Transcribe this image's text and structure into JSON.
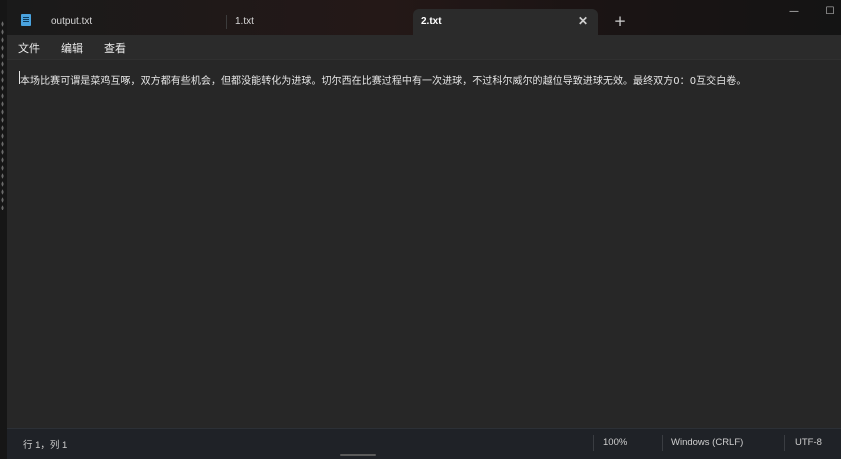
{
  "window": {
    "minimize_glyph": "—",
    "maximize_glyph": "☐"
  },
  "tabs": [
    {
      "label": "output.txt",
      "active": false
    },
    {
      "label": "1.txt",
      "active": false
    },
    {
      "label": "2.txt",
      "active": true
    }
  ],
  "tab_close_glyph": "✕",
  "new_tab_glyph": "+",
  "icons": {
    "app": "notepad-icon",
    "close": "close-icon",
    "add": "plus-icon"
  },
  "menu": {
    "file": "文件",
    "edit": "编辑",
    "view": "查看"
  },
  "editor": {
    "content": "本场比赛可谓是菜鸡互啄，双方都有些机会，但都没能转化为进球。切尔西在比赛过程中有一次进球，不过科尔威尔的越位导致进球无效。最终双方0：0互交白卷。"
  },
  "status": {
    "position": "行 1，列 1",
    "zoom": "100%",
    "line_ending": "Windows (CRLF)",
    "encoding": "UTF-8"
  },
  "colors": {
    "editor_bg": "#272727",
    "statusbar_bg": "#1f2227",
    "accent_icon": "#4aa3df"
  }
}
